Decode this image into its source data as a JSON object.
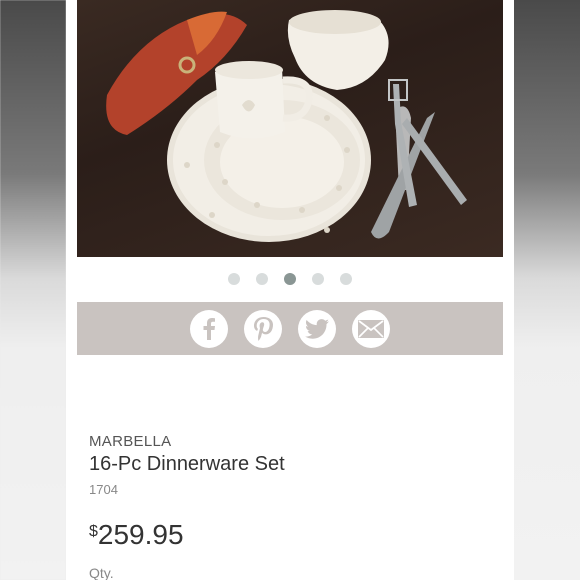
{
  "carousel": {
    "slides": 5,
    "active_index": 2
  },
  "share": {
    "icons": [
      "facebook-icon",
      "pinterest-icon",
      "twitter-icon",
      "email-icon"
    ]
  },
  "product": {
    "brand": "MARBELLA",
    "name": "16-Pc Dinnerware Set",
    "sku": "1704",
    "currency": "$",
    "price": "259.95",
    "qty_label": "Qty."
  },
  "colors": {
    "share_bar": "#c9c3c0",
    "dot_active": "#8a9694",
    "dot_inactive": "#d8dcdc"
  }
}
